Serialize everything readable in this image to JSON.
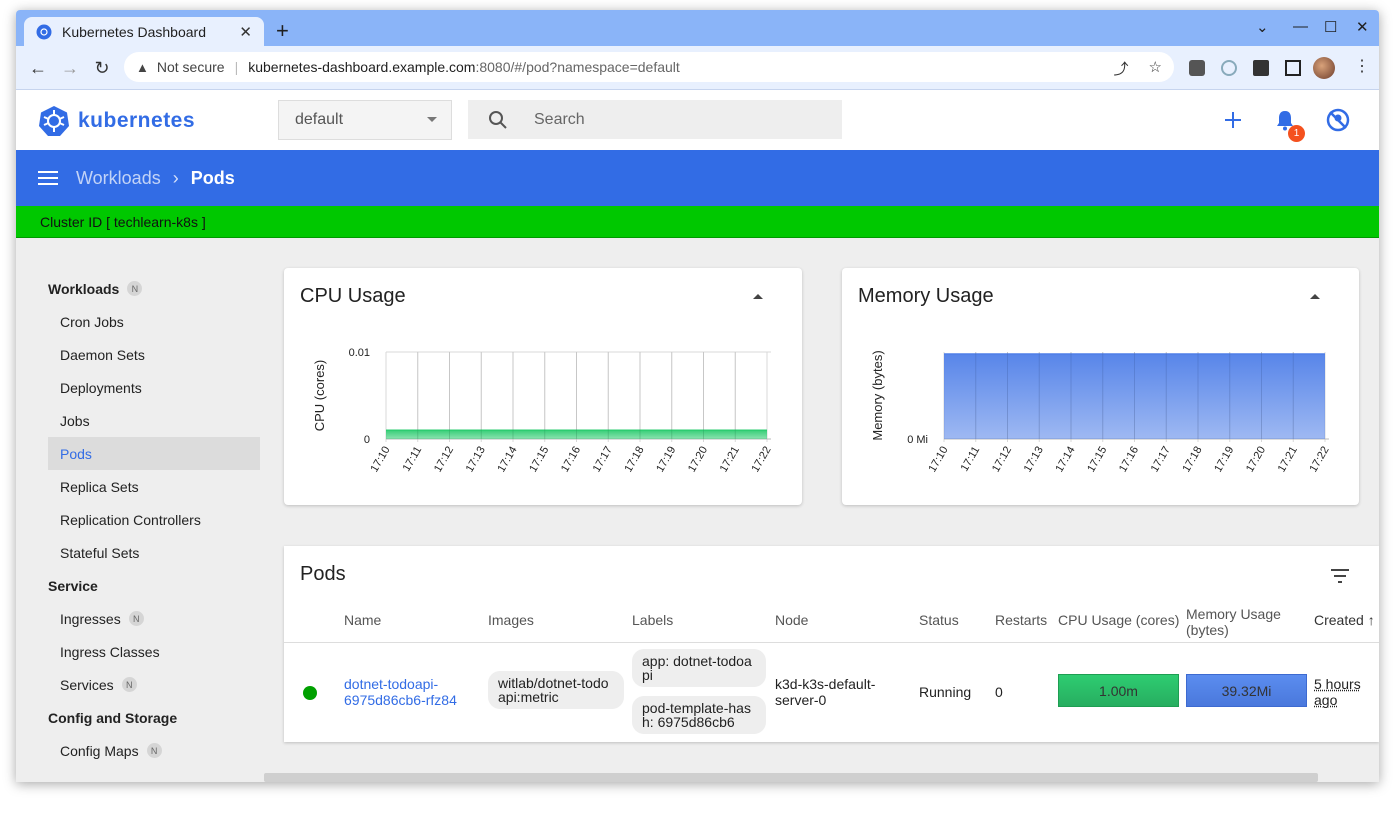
{
  "browser": {
    "tab_title": "Kubernetes Dashboard",
    "new_tab": "+",
    "close_tab": "✕",
    "not_secure": "Not secure",
    "url_host": "kubernetes-dashboard.example.com",
    "url_rest": ":8080/#/pod?namespace=default"
  },
  "header": {
    "logo_text": "kubernetes",
    "namespace": "default",
    "search_placeholder": "Search",
    "notification_count": "1"
  },
  "toolbar": {
    "breadcrumb_parent": "Workloads",
    "breadcrumb_current": "Pods"
  },
  "cluster": {
    "label": "Cluster ID [ techlearn-k8s ]"
  },
  "sidebar": {
    "groups": [
      {
        "label": "Workloads",
        "badge": "N"
      },
      {
        "label": "Service"
      },
      {
        "label": "Config and Storage"
      }
    ],
    "workloads": [
      "Cron Jobs",
      "Daemon Sets",
      "Deployments",
      "Jobs",
      "Pods",
      "Replica Sets",
      "Replication Controllers",
      "Stateful Sets"
    ],
    "service": [
      {
        "label": "Ingresses",
        "badge": "N"
      },
      {
        "label": "Ingress Classes"
      },
      {
        "label": "Services",
        "badge": "N"
      }
    ],
    "config": [
      {
        "label": "Config Maps",
        "badge": "N"
      }
    ]
  },
  "chart_data": [
    {
      "type": "area",
      "title": "CPU Usage",
      "ylabel": "CPU (cores)",
      "x": [
        "17:10",
        "17:11",
        "17:12",
        "17:13",
        "17:14",
        "17:15",
        "17:16",
        "17:17",
        "17:18",
        "17:19",
        "17:20",
        "17:21",
        "17:22"
      ],
      "y_ticks": [
        "0",
        "0.01"
      ],
      "ylim": [
        0,
        0.01
      ],
      "series": [
        {
          "values": [
            0.001,
            0.001,
            0.001,
            0.001,
            0.001,
            0.001,
            0.001,
            0.001,
            0.001,
            0.001,
            0.001,
            0.001,
            0.001
          ],
          "color": "#2ecc71"
        }
      ]
    },
    {
      "type": "area",
      "title": "Memory Usage",
      "ylabel": "Memory (bytes)",
      "x": [
        "17:10",
        "17:11",
        "17:12",
        "17:13",
        "17:14",
        "17:15",
        "17:16",
        "17:17",
        "17:18",
        "17:19",
        "17:20",
        "17:21",
        "17:22"
      ],
      "y_ticks": [
        "0 Mi"
      ],
      "series": [
        {
          "values": [
            39.32,
            39.32,
            39.32,
            39.32,
            39.32,
            39.32,
            39.32,
            39.32,
            39.32,
            39.32,
            39.32,
            39.32,
            39.32
          ],
          "color": "#4f7fe8"
        }
      ]
    }
  ],
  "pods": {
    "title": "Pods",
    "columns": {
      "name": "Name",
      "images": "Images",
      "labels": "Labels",
      "node": "Node",
      "status": "Status",
      "restarts": "Restarts",
      "cpu": "CPU Usage (cores)",
      "memory_line1": "Memory Usage",
      "memory_line2": "(bytes)",
      "created": "Created"
    },
    "rows": [
      {
        "name_line1": "dotnet-todoapi-",
        "name_line2": "6975d86cb6-rfz84",
        "image_line1": "witlab/dotnet-todo",
        "image_line2": "api:metric",
        "label1_line1": "app: dotnet-todoa",
        "label1_line2": "pi",
        "label2_line1": "pod-template-has",
        "label2_line2": "h: 6975d86cb6",
        "node_line1": "k3d-k3s-default-",
        "node_line2": "server-0",
        "status": "Running",
        "restarts": "0",
        "cpu": "1.00m",
        "memory": "39.32Mi",
        "created_line1": "5 hours",
        "created_line2": "ago"
      }
    ]
  }
}
